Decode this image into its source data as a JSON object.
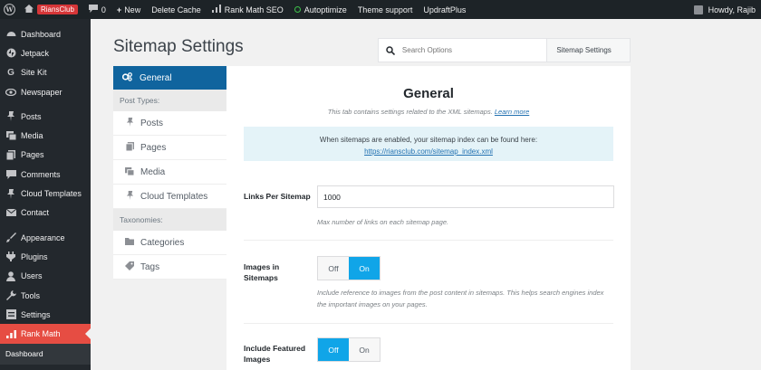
{
  "admin_bar": {
    "site_name": "RiansClub",
    "comments_count": "0",
    "new_label": "New",
    "items": [
      "Delete Cache",
      "Rank Math SEO",
      "Autoptimize",
      "Theme support",
      "UpdraftPlus"
    ],
    "greeting": "Howdy, Rajib"
  },
  "sidebar": {
    "items": [
      {
        "label": "Dashboard",
        "icon": "dashboard-icon"
      },
      {
        "label": "Jetpack",
        "icon": "jetpack-icon"
      },
      {
        "label": "Site Kit",
        "icon": "google-g-icon"
      },
      {
        "label": "Newspaper",
        "icon": "eye-icon"
      },
      {
        "label": "Posts",
        "icon": "pin-icon"
      },
      {
        "label": "Media",
        "icon": "media-icon"
      },
      {
        "label": "Pages",
        "icon": "pages-icon"
      },
      {
        "label": "Comments",
        "icon": "comment-icon"
      },
      {
        "label": "Cloud Templates",
        "icon": "pin-icon"
      },
      {
        "label": "Contact",
        "icon": "envelope-icon"
      },
      {
        "label": "Appearance",
        "icon": "brush-icon"
      },
      {
        "label": "Plugins",
        "icon": "plug-icon"
      },
      {
        "label": "Users",
        "icon": "user-icon"
      },
      {
        "label": "Tools",
        "icon": "wrench-icon"
      },
      {
        "label": "Settings",
        "icon": "settings-icon"
      },
      {
        "label": "Rank Math",
        "icon": "chart-icon"
      }
    ],
    "submenu_label": "Dashboard"
  },
  "page": {
    "title": "Sitemap Settings",
    "search_placeholder": "Search Options",
    "search_scope": "Sitemap Settings"
  },
  "tabs": {
    "active": "General",
    "post_types_heading": "Post Types:",
    "post_types": [
      "Posts",
      "Pages",
      "Media",
      "Cloud Templates"
    ],
    "taxonomies_heading": "Taxonomies:",
    "taxonomies": [
      "Categories",
      "Tags"
    ]
  },
  "panel": {
    "title": "General",
    "description": "This tab contains settings related to the XML sitemaps.",
    "learn_more": "Learn more",
    "info_text": "When sitemaps are enabled, your sitemap index can be found here:",
    "sitemap_url": "https://riansclub.com/sitemap_index.xml",
    "links_per_sitemap_label": "Links Per Sitemap",
    "links_per_sitemap_value": "1000",
    "links_per_sitemap_help": "Max number of links on each sitemap page.",
    "images_label": "Images in Sitemaps",
    "images_help": "Include reference to images from the post content in sitemaps. This helps search engines index the important images on your pages.",
    "featured_label": "Include Featured Images",
    "off_label": "Off",
    "on_label": "On",
    "images_state": "On",
    "featured_state": "Off"
  },
  "colors": {
    "admin_bar": "#1d2327",
    "sidebar": "#23282d",
    "active_menu": "#e64d43",
    "active_tab": "#10649e",
    "toggle_on": "#10a5e8",
    "info_box": "#e4f3f8"
  }
}
